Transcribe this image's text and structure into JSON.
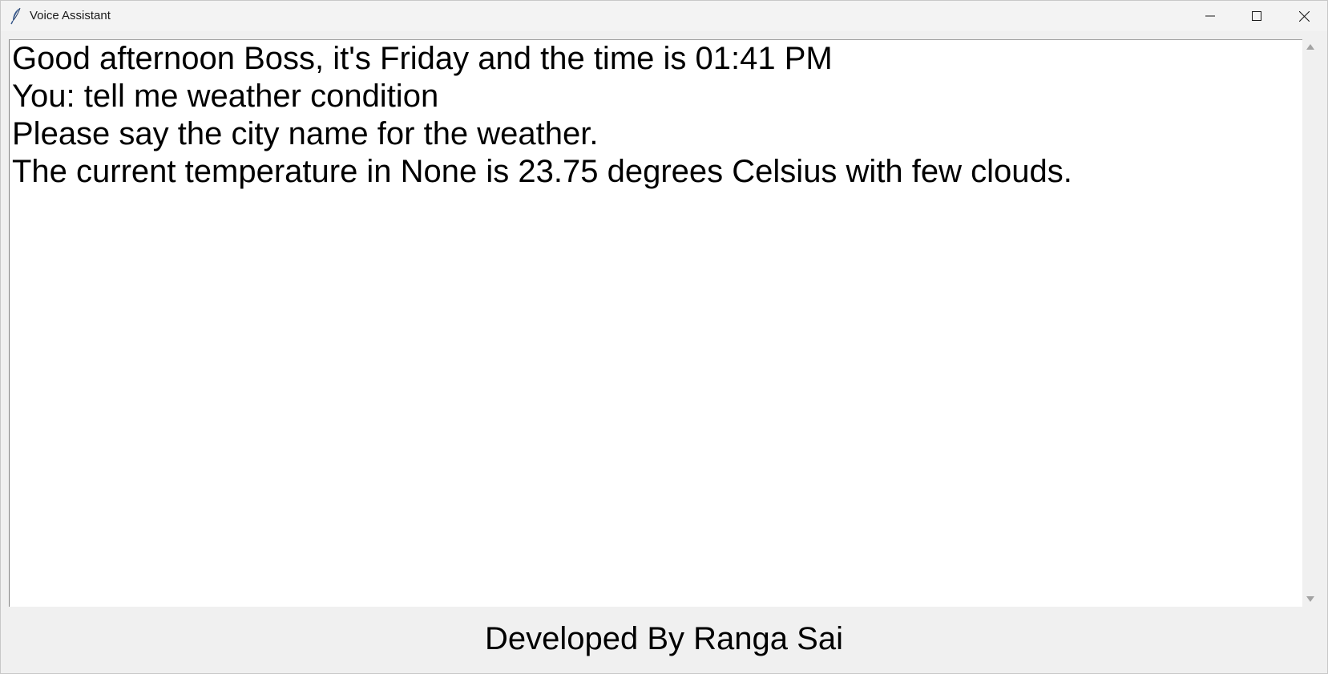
{
  "window": {
    "title": "Voice Assistant"
  },
  "conversation": {
    "lines": [
      "Good afternoon Boss, it's Friday and the time is 01:41 PM",
      "You: tell me weather condition",
      "Please say the city name for the weather.",
      "The current temperature in None is 23.75 degrees Celsius with few clouds."
    ]
  },
  "footer": {
    "credit": "Developed By Ranga Sai"
  },
  "icons": {
    "app": "feather-icon",
    "minimize": "minimize-icon",
    "maximize": "maximize-icon",
    "close": "close-icon"
  }
}
